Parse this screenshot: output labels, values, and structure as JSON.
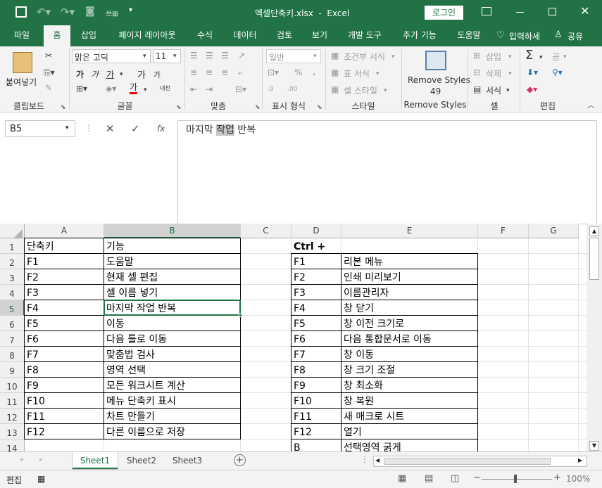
{
  "titlebar": {
    "doc_title": "엑셀단축키.xlsx  -  Excel",
    "login": "로그인",
    "qat_label": "쓰⊞"
  },
  "tabs": [
    "파일",
    "홈",
    "삽입",
    "페이지 레이아웃",
    "수식",
    "데이터",
    "검토",
    "보기",
    "개발 도구",
    "추가 기능",
    "도움말"
  ],
  "tell_me": "입력하세",
  "share": "공유",
  "ribbon": {
    "clipboard": {
      "paste": "붙여넣기",
      "label": "클립보드"
    },
    "font": {
      "name": "맑은 고딕",
      "size": "11",
      "label": "글꼴",
      "bold": "가",
      "italic": "가",
      "underline": "가",
      "grow": "가",
      "shrink": "가",
      "color": "가",
      "phonetic": "내천"
    },
    "alignment": {
      "label": "맞춤"
    },
    "number": {
      "format": "일반",
      "label": "표시 형식",
      "percent": "%",
      "comma": ","
    },
    "styles": {
      "cond": "조건부 서식",
      "table": "표 서식",
      "cell": "셀 스타일",
      "label": "스타일"
    },
    "remove_styles": {
      "line1": "Remove Styles",
      "count": "49",
      "label": "Remove Styles"
    },
    "cells": {
      "insert": "삽입",
      "delete": "삭제",
      "format": "서식",
      "label": "셀"
    },
    "editing": {
      "label": "편집",
      "sum": "Σ",
      "sort": "공"
    }
  },
  "namebox": "B5",
  "formula": {
    "pre": "마지막 ",
    "hl": "작업",
    "post": " 반복"
  },
  "columns": [
    "A",
    "B",
    "C",
    "D",
    "E",
    "F",
    "G"
  ],
  "rows": [
    "1",
    "2",
    "3",
    "4",
    "5",
    "6",
    "7",
    "8",
    "9",
    "10",
    "11",
    "12",
    "13",
    "14"
  ],
  "colA": [
    "단축키",
    "F1",
    "F2",
    "F3",
    "F4",
    "F5",
    "F6",
    "F7",
    "F8",
    "F9",
    "F10",
    "F11",
    "F12"
  ],
  "colB": [
    "기능",
    "도움말",
    "현재 셀 편집",
    "셀 이름 넣기",
    "마지막 작업 반복",
    "이동",
    "다음 틀로 이동",
    "맞춤법 검사",
    "영역 선택",
    "모든 워크시트 계산",
    "메뉴 단축키 표시",
    "차트 만들기",
    "다른 이름으로 저장"
  ],
  "colD": [
    "Ctrl +",
    "F1",
    "F2",
    "F3",
    "F4",
    "F5",
    "F6",
    "F7",
    "F8",
    "F9",
    "F10",
    "F11",
    "F12",
    "B"
  ],
  "colE": [
    "",
    "리본 메뉴",
    "인쇄 미리보기",
    "이름관리자",
    "창 닫기",
    "창 이전 크기로",
    "다음 통합문서로 이동",
    "창 이동",
    "창 크기 조절",
    "창 최소화",
    "창 복원",
    "새 매크로 시트",
    "열기",
    "선택영역 굵게"
  ],
  "sheets": [
    "Sheet1",
    "Sheet2",
    "Sheet3"
  ],
  "status": {
    "mode": "편집",
    "zoom": "100%"
  },
  "colors": {
    "accent": "#217346",
    "selection": "#217346"
  }
}
